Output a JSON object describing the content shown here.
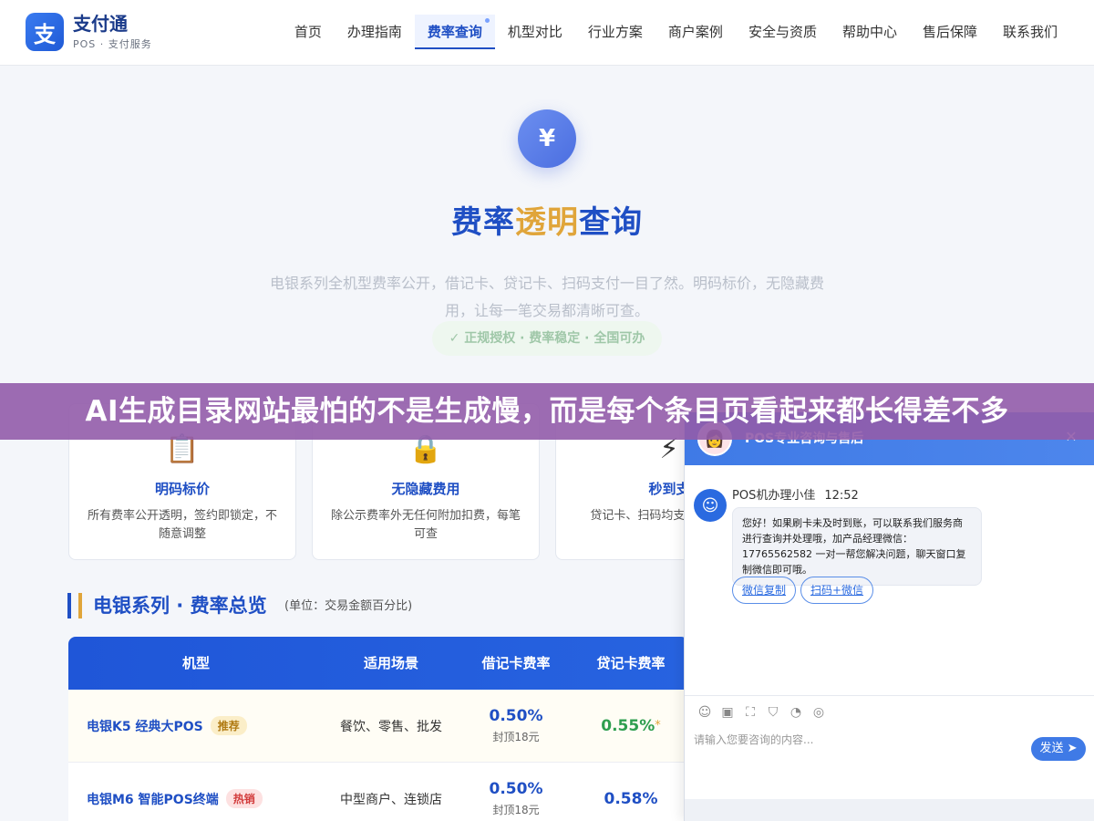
{
  "brand": {
    "logo_char": "支",
    "name": "支付通",
    "subtitle": "POS · 支付服务"
  },
  "nav": {
    "items": [
      {
        "label": "首页"
      },
      {
        "label": "办理指南"
      },
      {
        "label": "费率查询"
      },
      {
        "label": "机型对比"
      },
      {
        "label": "行业方案"
      },
      {
        "label": "商户案例"
      },
      {
        "label": "安全与资质"
      },
      {
        "label": "帮助中心"
      },
      {
        "label": "售后保障"
      },
      {
        "label": "联系我们"
      }
    ],
    "active_index": 2
  },
  "hero": {
    "icon_char": "¥",
    "title_part1": "费率",
    "title_highlight": "透明",
    "title_part2": "查询",
    "description": "电银系列全机型费率公开，借记卡、贷记卡、扫码支付一目了然。明码标价，无隐藏费用，让每一笔交易都清晰可查。",
    "badge": "✓ 正规授权 · 费率稳定 · 全国可办"
  },
  "features": [
    {
      "icon": "clipboard-icon",
      "glyph": "📋",
      "title": "明码标价",
      "desc": "所有费率公开透明，签约即锁定，不随意调整"
    },
    {
      "icon": "lock-icon",
      "glyph": "🔒",
      "title": "无隐藏费用",
      "desc": "除公示费率外无任何附加扣费，每笔可查"
    },
    {
      "icon": "lightning-icon",
      "glyph": "⚡",
      "title": "秒到支",
      "desc": "贷记卡、扫码均支持 资金周转"
    }
  ],
  "section": {
    "title": "电银系列 · 费率总览",
    "unit": "(单位：交易金额百分比)"
  },
  "table": {
    "headers": [
      "机型",
      "适用场景",
      "借记卡费率",
      "贷记卡费率"
    ],
    "rows": [
      {
        "model": "电银K5 经典大POS",
        "tag": "推荐",
        "tag_type": "rec",
        "scene": "餐饮、零售、批发",
        "debit": "0.50%",
        "debit_cap": "封顶18元",
        "credit": "0.55%",
        "credit_star": "*"
      },
      {
        "model": "电银M6 智能POS终端",
        "tag": "热销",
        "tag_type": "hot",
        "scene": "中型商户、连锁店",
        "debit": "0.50%",
        "debit_cap": "封顶18元",
        "credit": "0.58%",
        "credit_star": ""
      }
    ]
  },
  "banner": "AI生成目录网站最怕的不是生成慢，而是每个条目页看起来都长得差不多",
  "chat": {
    "header_title": "POS专业咨询与售后",
    "agent_name": "POS机办理小佳",
    "time": "12:52",
    "message": "您好！如果刷卡未及时到账，可以联系我们服务商进行查询并处理哦，加产品经理微信：17765562582 一对一帮您解决问题，聊天窗口复制微信即可哦。",
    "chips": [
      "微信复制",
      "扫码+微信"
    ],
    "input_placeholder": "请输入您要咨询的内容...",
    "send_label": "发送"
  },
  "colors": {
    "primary": "#1f4fc4",
    "accent": "#e0a53a",
    "banner": "#925caa",
    "chat": "#3f7ae6"
  }
}
